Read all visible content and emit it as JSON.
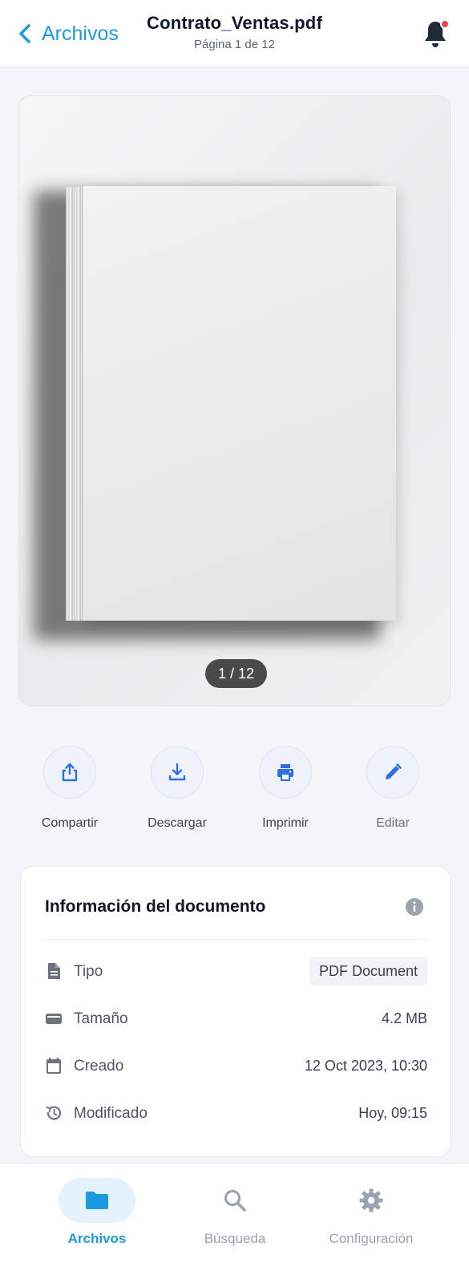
{
  "header": {
    "back_label": "Archivos",
    "title": "Contrato_Ventas.pdf",
    "subtitle": "Página 1 de 12",
    "back_icon": "chevron-left-icon",
    "bell_icon": "bell-icon",
    "notification_dot_color": "#ef4444"
  },
  "preview": {
    "page_indicator": "1 / 12"
  },
  "actions": [
    {
      "label": "Compartir",
      "icon": "share-icon"
    },
    {
      "label": "Descargar",
      "icon": "download-icon"
    },
    {
      "label": "Imprimir",
      "icon": "printer-icon"
    },
    {
      "label": "Editar",
      "icon": "pencil-icon"
    }
  ],
  "info": {
    "title": "Información del documento",
    "rows": [
      {
        "label": "Tipo",
        "value": "PDF Document",
        "icon": "file-icon"
      },
      {
        "label": "Tamaño",
        "value": "4.2 MB",
        "icon": "storage-icon"
      },
      {
        "label": "Creado",
        "value": "12 Oct 2023, 10:30",
        "icon": "calendar-icon"
      },
      {
        "label": "Modificado",
        "value": "Hoy, 09:15",
        "icon": "history-icon"
      }
    ]
  },
  "tabbar": {
    "tabs": [
      {
        "label": "Archivos",
        "icon": "folder-icon",
        "active": true
      },
      {
        "label": "Búsqueda",
        "icon": "search-icon",
        "active": false
      },
      {
        "label": "Configuración",
        "icon": "gear-icon",
        "active": false
      }
    ]
  },
  "colors": {
    "accent": "#1a9ae0",
    "action_icon": "#2f6fe0",
    "muted_icon": "#6b7280"
  }
}
